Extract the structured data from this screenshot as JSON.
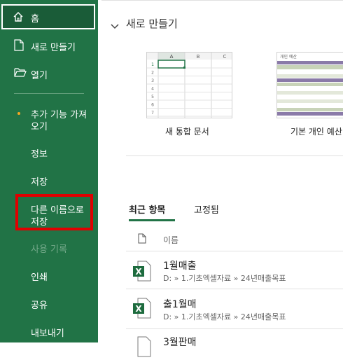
{
  "sidebar": {
    "home_label": "홈",
    "new_label": "새로 만들기",
    "open_label": "열기",
    "addins_label_line1": "추가 기능 가져",
    "addins_label_line2": "오기",
    "info_label": "정보",
    "save_label": "저장",
    "saveas_label_line1": "다른 이름으로",
    "saveas_label_line2": "저장",
    "history_label": "사용 기록",
    "print_label": "인쇄",
    "share_label": "공유",
    "export_label": "내보내기"
  },
  "main": {
    "section_title": "새로 만들기",
    "templates": [
      {
        "label": "새 통합 문서"
      },
      {
        "label": "기본 개인 예산"
      }
    ],
    "thumb1": {
      "col_a": "A",
      "col_b": "B",
      "col_c": "C",
      "rows": [
        "1",
        "2",
        "3",
        "4",
        "5",
        "6",
        "7"
      ]
    },
    "thumb2": {
      "title": "개인 예산"
    },
    "tabs": [
      {
        "label": "최근 항목",
        "active": true
      },
      {
        "label": "고정됨",
        "active": false
      }
    ],
    "column_name": "이름",
    "files": [
      {
        "name": "1월매출",
        "path": "D: » 1.기초엑셀자료 » 24년매출목표"
      },
      {
        "name": "출1월매",
        "path": "D: » 1.기초엑셀자료 » 24년매출목표"
      },
      {
        "name": "3월판매",
        "path": ""
      }
    ]
  },
  "colors": {
    "sidebar_bg": "#217346",
    "highlight": "#e00000",
    "accent_dot": "#f5a623"
  }
}
